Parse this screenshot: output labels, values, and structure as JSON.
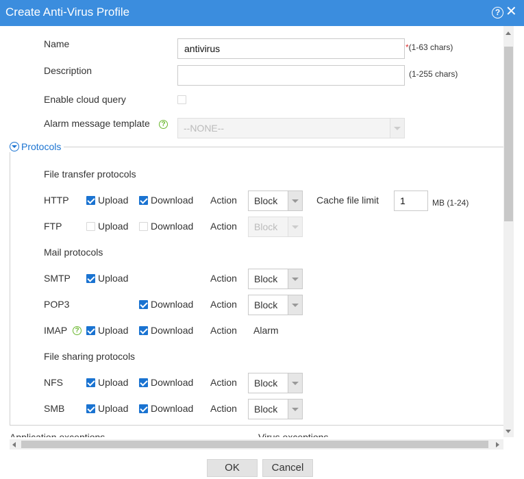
{
  "dialog": {
    "title": "Create Anti-Virus Profile"
  },
  "form": {
    "name": {
      "label": "Name",
      "value": "antivirus",
      "required_mark": "*",
      "hint": "(1-63 chars)"
    },
    "description": {
      "label": "Description",
      "value": "",
      "hint": "(1-255 chars)"
    },
    "cloud_query": {
      "label": "Enable cloud query",
      "checked": false
    },
    "alarm_template": {
      "label": "Alarm message template",
      "value": "--NONE--"
    }
  },
  "protocols": {
    "title": "Protocols",
    "file_transfer": "File transfer protocols",
    "mail": "Mail protocols",
    "file_sharing": "File sharing protocols",
    "upload_label": "Upload",
    "download_label": "Download",
    "action_label": "Action",
    "cache_label": "Cache file limit",
    "cache_value": "1",
    "cache_hint": "MB (1-24)",
    "rows": [
      {
        "name": "HTTP",
        "upload": true,
        "download": true,
        "action": "Block"
      },
      {
        "name": "FTP",
        "upload": false,
        "download": false,
        "action": "Block",
        "disabled": true
      },
      {
        "name": "SMTP",
        "upload": true,
        "action": "Block"
      },
      {
        "name": "POP3",
        "download": true,
        "action": "Block"
      },
      {
        "name": "IMAP",
        "upload": true,
        "download": true,
        "action": "Alarm"
      },
      {
        "name": "NFS",
        "upload": true,
        "download": true,
        "action": "Block"
      },
      {
        "name": "SMB",
        "upload": true,
        "download": true,
        "action": "Block"
      }
    ]
  },
  "exceptions": {
    "application": "Application exceptions",
    "virus": "Virus exceptions"
  },
  "buttons": {
    "ok": "OK",
    "cancel": "Cancel"
  }
}
